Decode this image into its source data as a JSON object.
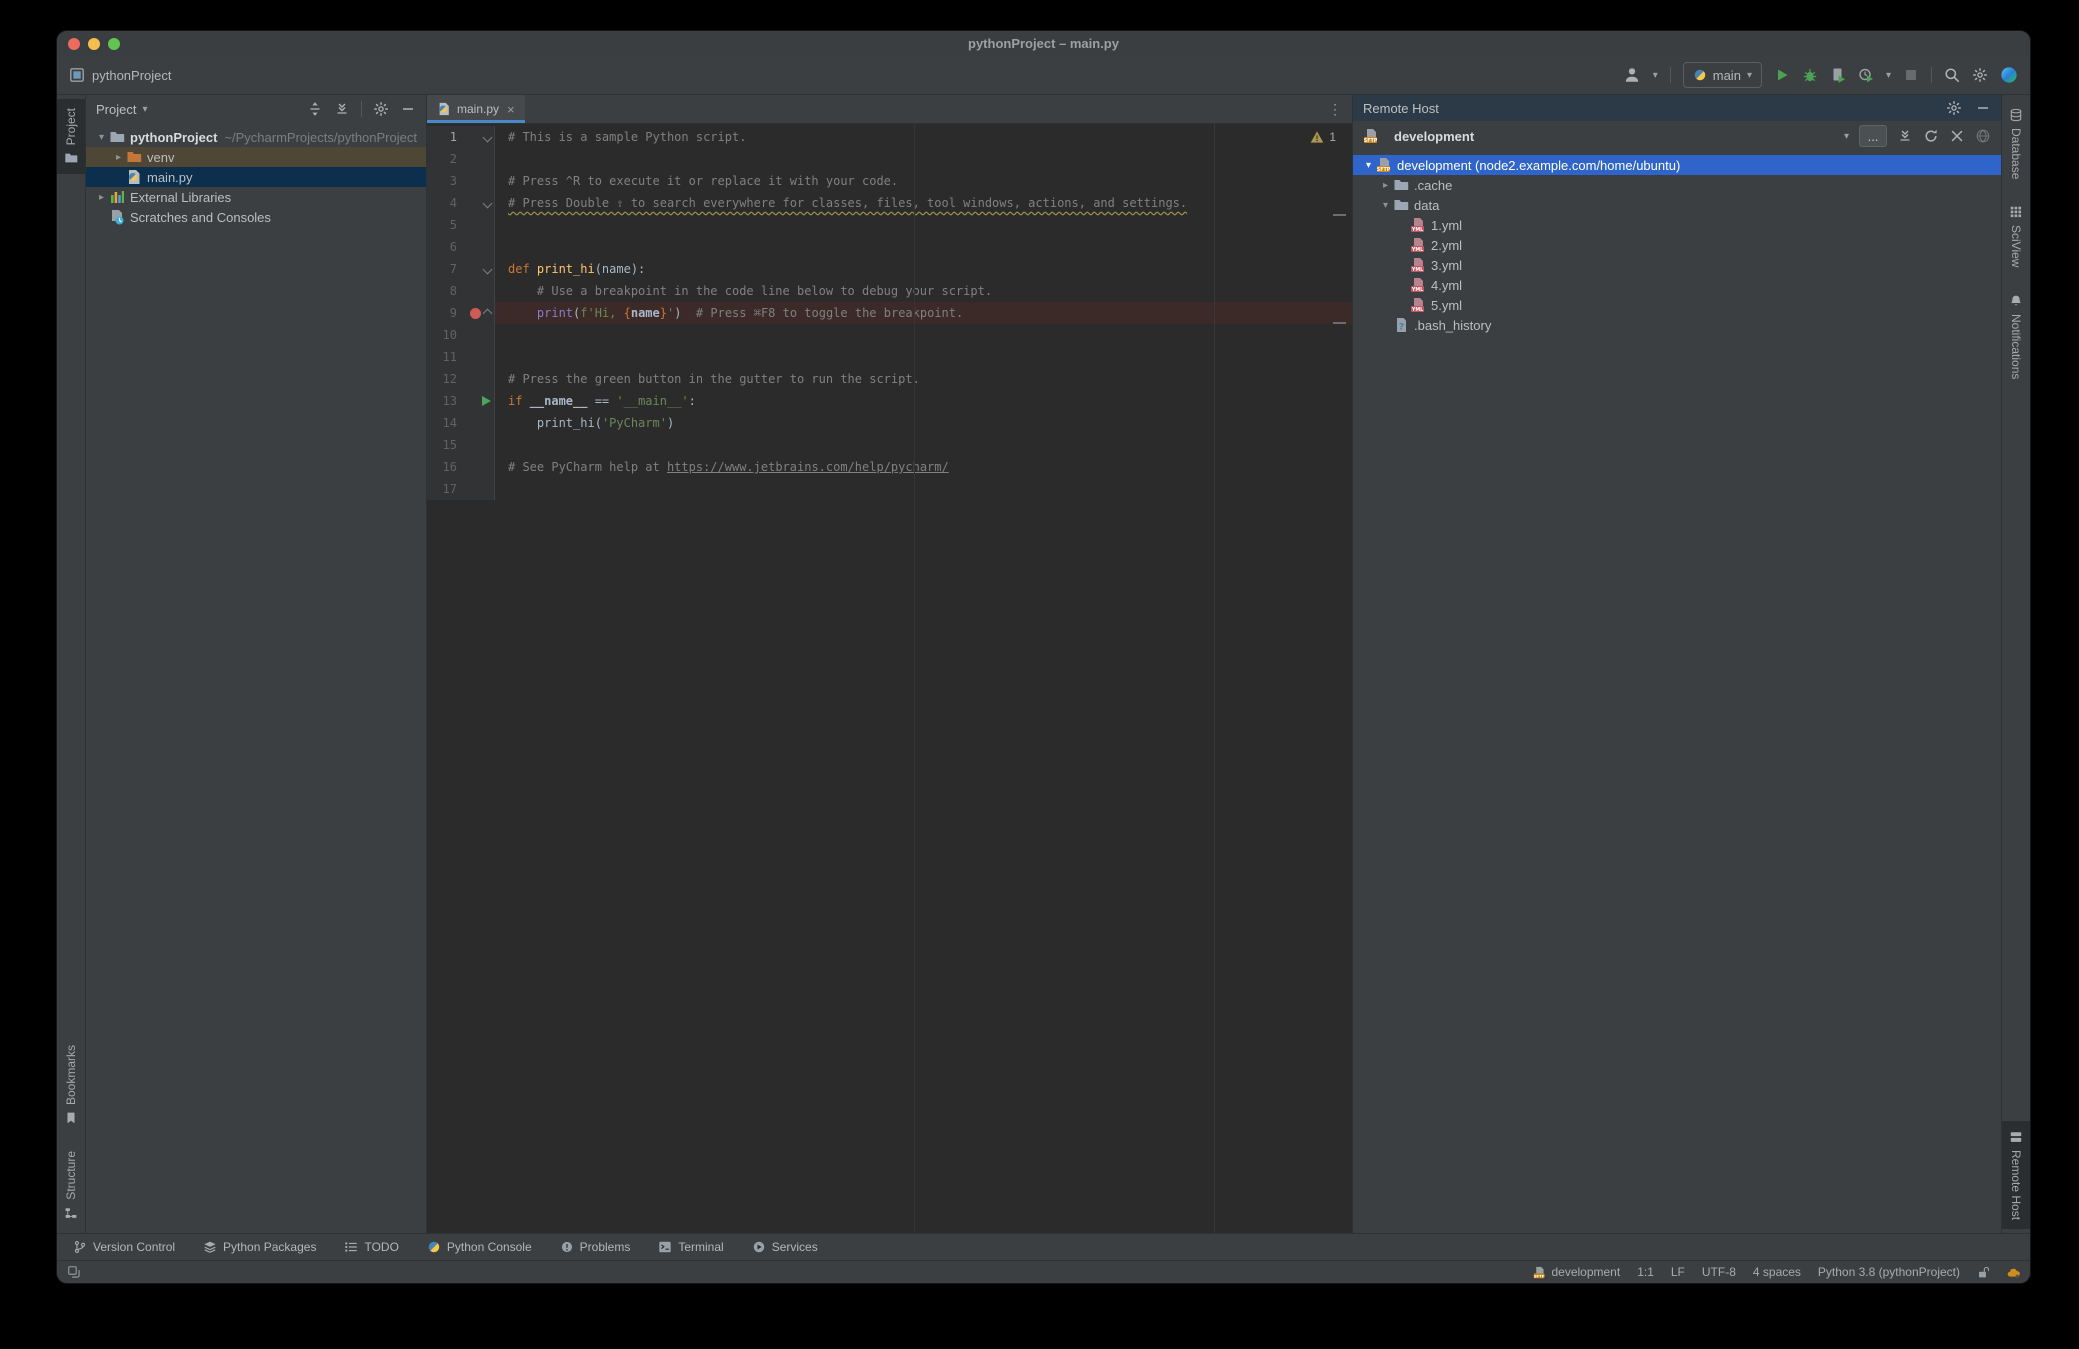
{
  "window": {
    "title": "pythonProject – main.py"
  },
  "toolbar": {
    "breadcrumb": "pythonProject",
    "run_config": "main"
  },
  "left_stripe": {
    "top": [
      {
        "label": "Project",
        "icon": "folder",
        "selected": true
      }
    ],
    "bottom": [
      {
        "label": "Bookmarks",
        "icon": "bookmark"
      },
      {
        "label": "Structure",
        "icon": "structure"
      }
    ]
  },
  "right_stripe": {
    "top": [
      {
        "label": "Database",
        "icon": "database"
      },
      {
        "label": "SciView",
        "icon": "grid"
      },
      {
        "label": "Notifications",
        "icon": "bell"
      }
    ],
    "bottom": [
      {
        "label": "Remote Host",
        "icon": "server",
        "selected": true
      }
    ]
  },
  "project_panel": {
    "title": "Project",
    "tree": [
      {
        "indent": 0,
        "chevron": "down",
        "icon": "folder",
        "label": "pythonProject",
        "bold": true,
        "suffix": "~/PycharmProjects/pythonProject"
      },
      {
        "indent": 1,
        "chevron": "right",
        "icon": "folder-excluded",
        "label": "venv",
        "state": "excluded"
      },
      {
        "indent": 1,
        "chevron": null,
        "icon": "python-file",
        "label": "main.py",
        "state": "selected-unfocused"
      },
      {
        "indent": 0,
        "chevron": "right",
        "icon": "libraries",
        "label": "External Libraries"
      },
      {
        "indent": 0,
        "chevron": null,
        "icon": "scratches",
        "label": "Scratches and Consoles"
      }
    ]
  },
  "editor": {
    "tab": {
      "label": "main.py",
      "close": "×"
    },
    "more_tabs": "⋮",
    "inspection": {
      "warnings": "1"
    },
    "lines": [
      {
        "n": "1",
        "numHl": true,
        "gutter": [
          "fold-down"
        ],
        "seg": [
          [
            "# This is a sample Python script.",
            "comment"
          ]
        ]
      },
      {
        "n": "2",
        "seg": []
      },
      {
        "n": "3",
        "seg": [
          [
            "# Press ^R to execute it or replace it with your code.",
            "comment"
          ]
        ]
      },
      {
        "n": "4",
        "gutter": [
          "fold-down"
        ],
        "seg": [
          [
            "# Press Double ⇧ to search everywhere for classes, files, tool windows, actions, and settings.",
            "comment-typo"
          ]
        ]
      },
      {
        "n": "5",
        "seg": []
      },
      {
        "n": "6",
        "seg": []
      },
      {
        "n": "7",
        "gutter": [
          "fold-down"
        ],
        "seg": [
          [
            "def ",
            "keyword"
          ],
          [
            "print_hi",
            "funcdef"
          ],
          [
            "(name):",
            "plain"
          ]
        ]
      },
      {
        "n": "8",
        "seg": [
          [
            "    # Use a breakpoint in the code line below to debug your script.",
            "comment"
          ]
        ]
      },
      {
        "n": "9",
        "bg": "breakpoint",
        "gutter": [
          "breakpoint",
          "fold-up"
        ],
        "seg": [
          [
            "    ",
            "plain"
          ],
          [
            "print",
            "builtin"
          ],
          [
            "(",
            "plain"
          ],
          [
            "f'Hi, ",
            "string"
          ],
          [
            "{",
            "brace"
          ],
          [
            "name",
            "plain-bold"
          ],
          [
            "}",
            "brace"
          ],
          [
            "'",
            "string"
          ],
          [
            ")",
            "plain"
          ],
          [
            "  # Press ⌘F8 to toggle the breakpoint.",
            "comment"
          ]
        ]
      },
      {
        "n": "10",
        "seg": []
      },
      {
        "n": "11",
        "seg": []
      },
      {
        "n": "12",
        "seg": [
          [
            "# Press the green button in the gutter to run the script.",
            "comment"
          ]
        ]
      },
      {
        "n": "13",
        "gutter": [
          "run"
        ],
        "seg": [
          [
            "if ",
            "keyword"
          ],
          [
            "__name__",
            "plain-bold"
          ],
          [
            " == ",
            "plain"
          ],
          [
            "'__main__'",
            "string"
          ],
          [
            ":",
            "plain"
          ]
        ]
      },
      {
        "n": "14",
        "seg": [
          [
            "    ",
            "plain"
          ],
          [
            "print_hi",
            "plain"
          ],
          [
            "(",
            "plain"
          ],
          [
            "'PyCharm'",
            "string"
          ],
          [
            ")",
            "plain"
          ]
        ]
      },
      {
        "n": "15",
        "seg": []
      },
      {
        "n": "16",
        "seg": [
          [
            "# See PyCharm help at ",
            "comment"
          ],
          [
            "https://www.jetbrains.com/help/pycharm/",
            "comment-link"
          ]
        ]
      },
      {
        "n": "17",
        "seg": []
      }
    ]
  },
  "remote_host": {
    "title": "Remote Host",
    "server": "development",
    "browse_label": "...",
    "tree": [
      {
        "indent": 0,
        "chevron": "down",
        "icon": "sftp",
        "label": "development (node2.example.com/home/ubuntu)",
        "state": "selected-focused"
      },
      {
        "indent": 1,
        "chevron": "right",
        "icon": "folder",
        "label": ".cache"
      },
      {
        "indent": 1,
        "chevron": "down",
        "icon": "folder",
        "label": "data"
      },
      {
        "indent": 2,
        "chevron": null,
        "icon": "yml",
        "label": "1.yml"
      },
      {
        "indent": 2,
        "chevron": null,
        "icon": "yml",
        "label": "2.yml"
      },
      {
        "indent": 2,
        "chevron": null,
        "icon": "yml",
        "label": "3.yml"
      },
      {
        "indent": 2,
        "chevron": null,
        "icon": "yml",
        "label": "4.yml"
      },
      {
        "indent": 2,
        "chevron": null,
        "icon": "yml",
        "label": "5.yml"
      },
      {
        "indent": 1,
        "chevron": null,
        "icon": "file-unknown",
        "label": ".bash_history"
      }
    ]
  },
  "bottom_bar": {
    "items": [
      {
        "label": "Version Control",
        "icon": "branch"
      },
      {
        "label": "Python Packages",
        "icon": "stack"
      },
      {
        "label": "TODO",
        "icon": "todo"
      },
      {
        "label": "Python Console",
        "icon": "python"
      },
      {
        "label": "Problems",
        "icon": "problems"
      },
      {
        "label": "Terminal",
        "icon": "terminal"
      },
      {
        "label": "Services",
        "icon": "services"
      }
    ]
  },
  "status_bar": {
    "items": [
      {
        "icon": "sftp",
        "label": "development"
      },
      {
        "label": "1:1"
      },
      {
        "label": "LF"
      },
      {
        "label": "UTF-8"
      },
      {
        "label": "4 spaces"
      },
      {
        "label": "Python 3.8 (pythonProject)"
      },
      {
        "icon": "unlock",
        "label": ""
      },
      {
        "icon": "cloud-sync",
        "label": ""
      }
    ]
  },
  "colors": {
    "selection_blue": "#2f65ca",
    "breakpoint_red": "#cf5b56",
    "run_green": "#4da154",
    "warning_yellow": "#9d9345",
    "editor_bg": "#2b2b2b",
    "panel_bg": "#3c3f41"
  }
}
